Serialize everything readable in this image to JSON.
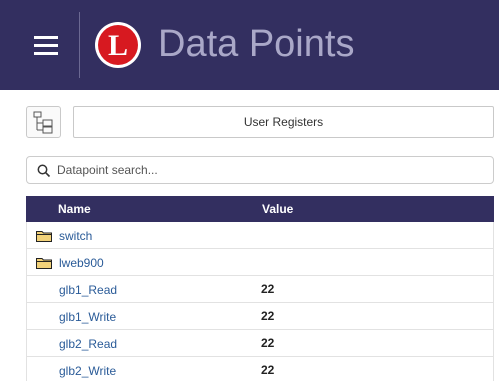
{
  "header": {
    "title": "Data Points",
    "logo_letter": "L",
    "background": "#332f60",
    "logo_color": "#d71920"
  },
  "toolbar": {
    "tree_icon": "tree-view-icon",
    "registers_label": "User Registers"
  },
  "search": {
    "placeholder": "Datapoint search...",
    "value": ""
  },
  "table": {
    "columns": [
      "Name",
      "Value"
    ],
    "folders": [
      {
        "name": "switch"
      },
      {
        "name": "lweb900"
      }
    ],
    "rows": [
      {
        "name": "glb1_Read",
        "value": "22"
      },
      {
        "name": "glb1_Write",
        "value": "22"
      },
      {
        "name": "glb2_Read",
        "value": "22"
      },
      {
        "name": "glb2_Write",
        "value": "22"
      }
    ]
  }
}
